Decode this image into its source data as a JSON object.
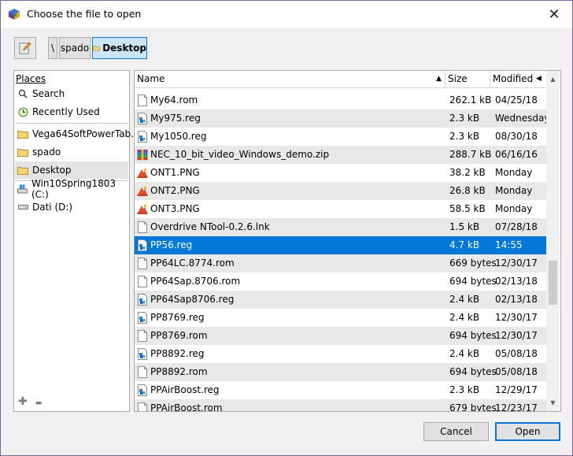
{
  "window": {
    "title": "Choose the file to open",
    "close_glyph": "✕"
  },
  "breadcrumb": {
    "root": "\\",
    "items": [
      "spado",
      "Desktop"
    ]
  },
  "places": {
    "header": "Places",
    "items": [
      {
        "label": "Search",
        "icon": "search-icon"
      },
      {
        "label": "Recently Used",
        "icon": "recent-icon"
      },
      {
        "label": "Vega64SoftPowerTab...",
        "icon": "folder-icon"
      },
      {
        "label": "spado",
        "icon": "folder-icon"
      },
      {
        "label": "Desktop",
        "icon": "folder-icon"
      },
      {
        "label": "Win10Spring1803 (C:)",
        "icon": "drive-icon"
      },
      {
        "label": "Dati (D:)",
        "icon": "drive-icon"
      }
    ],
    "add_glyph": "✚",
    "remove_glyph": "▬"
  },
  "files": {
    "columns": {
      "name": "Name",
      "size": "Size",
      "modified": "Modified"
    },
    "sort_glyph": "▲",
    "rows": [
      {
        "name": "My64.rom",
        "size": "262.1 kB",
        "modified": "04/25/18",
        "type": "rom"
      },
      {
        "name": "My975.reg",
        "size": "2.3 kB",
        "modified": "Wednesday",
        "type": "reg"
      },
      {
        "name": "My1050.reg",
        "size": "2.3 kB",
        "modified": "08/30/18",
        "type": "reg"
      },
      {
        "name": "NEC_10_bit_video_Windows_demo.zip",
        "size": "288.7 kB",
        "modified": "06/16/16",
        "type": "zip"
      },
      {
        "name": "ONT1.PNG",
        "size": "38.2 kB",
        "modified": "Monday",
        "type": "png"
      },
      {
        "name": "ONT2.PNG",
        "size": "26.8 kB",
        "modified": "Monday",
        "type": "png"
      },
      {
        "name": "ONT3.PNG",
        "size": "58.5 kB",
        "modified": "Monday",
        "type": "png"
      },
      {
        "name": "Overdrive NTool-0.2.6.lnk",
        "size": "1.5 kB",
        "modified": "07/28/18",
        "type": "lnk"
      },
      {
        "name": "PP56.reg",
        "size": "4.7 kB",
        "modified": "14:55",
        "type": "reg",
        "selected": true
      },
      {
        "name": "PP64LC.8774.rom",
        "size": "669 bytes",
        "modified": "12/30/17",
        "type": "rom"
      },
      {
        "name": "PP64Sap.8706.rom",
        "size": "694 bytes",
        "modified": "02/13/18",
        "type": "rom"
      },
      {
        "name": "PP64Sap8706.reg",
        "size": "2.4 kB",
        "modified": "02/13/18",
        "type": "reg"
      },
      {
        "name": "PP8769.reg",
        "size": "2.4 kB",
        "modified": "12/30/17",
        "type": "reg"
      },
      {
        "name": "PP8769.rom",
        "size": "694 bytes",
        "modified": "12/30/17",
        "type": "rom"
      },
      {
        "name": "PP8892.reg",
        "size": "2.4 kB",
        "modified": "05/08/18",
        "type": "reg"
      },
      {
        "name": "PP8892.rom",
        "size": "694 bytes",
        "modified": "05/08/18",
        "type": "rom"
      },
      {
        "name": "PPAirBoost.reg",
        "size": "2.3 kB",
        "modified": "12/29/17",
        "type": "reg"
      },
      {
        "name": "PPAirBoost.rom",
        "size": "679 bytes",
        "modified": "12/23/17",
        "type": "rom"
      }
    ]
  },
  "buttons": {
    "cancel": "Cancel",
    "open": "Open"
  },
  "colors": {
    "selection": "#0078d7",
    "alt_row": "#e8e8e8"
  }
}
